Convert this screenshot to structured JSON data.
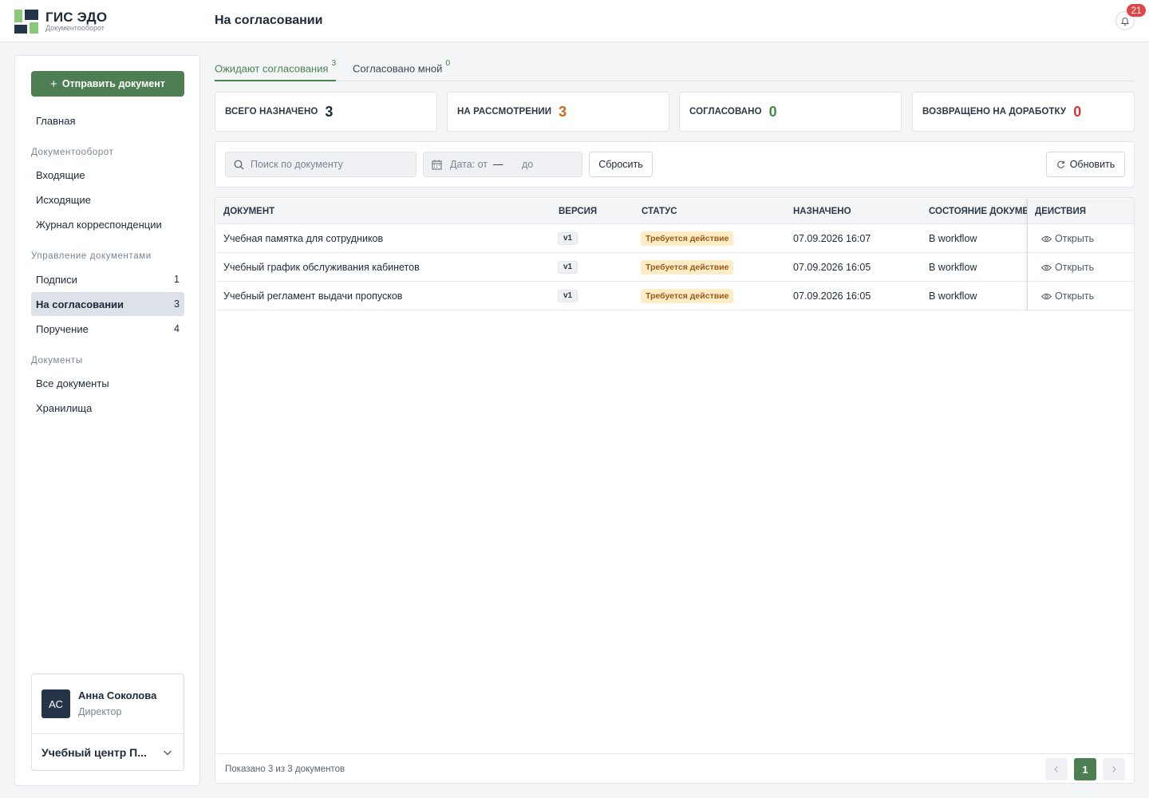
{
  "app": {
    "logo_title": "ГИС ЭДО",
    "logo_subtitle": "Документооборот",
    "page_title": "На согласовании",
    "notification_count": "21"
  },
  "sidebar": {
    "send_button": "Отправить документ",
    "home": "Главная",
    "section_docflow": "Документооборот",
    "incoming": "Входящие",
    "outgoing": "Исходящие",
    "journal": "Журнал корреспонденции",
    "section_manage": "Управление документами",
    "signatures": {
      "label": "Подписи",
      "count": "1"
    },
    "approval": {
      "label": "На согласовании",
      "count": "3"
    },
    "assignment": {
      "label": "Поручение",
      "count": "4"
    },
    "section_docs": "Документы",
    "all_docs": "Все документы",
    "storages": "Хранилища"
  },
  "user": {
    "initials": "АС",
    "name": "Анна Соколова",
    "role": "Директор",
    "org": "Учебный центр П..."
  },
  "tabs": [
    {
      "label": "Ожидают согласования",
      "count": "3"
    },
    {
      "label": "Согласовано мной",
      "count": "0"
    }
  ],
  "stats": [
    {
      "label": "ВСЕГО НАЗНАЧЕНО",
      "value": "3",
      "color": "#1e2a38"
    },
    {
      "label": "НА РАССМОТРЕНИИ",
      "value": "3",
      "color": "#c7681c"
    },
    {
      "label": "СОГЛАСОВАНО",
      "value": "0",
      "color": "#3f8a46"
    },
    {
      "label": "ВОЗВРАЩЕНО НА ДОРАБОТКУ",
      "value": "0",
      "color": "#d03a3a"
    }
  ],
  "filters": {
    "search_placeholder": "Поиск по документу",
    "date_from": "Дата: от",
    "date_dash": "—",
    "date_to": "до",
    "reset": "Сбросить",
    "refresh": "Обновить"
  },
  "table": {
    "headers": {
      "document": "ДОКУМЕНТ",
      "version": "ВЕРСИЯ",
      "status": "СТАТУС",
      "assigned": "НАЗНАЧЕНО",
      "state": "СОСТОЯНИЕ ДОКУМЕНТА",
      "actions": "ДЕЙСТВИЯ"
    },
    "rows": [
      {
        "document": "Учебная памятка для сотрудников",
        "version": "v1",
        "status": "Требуется действие",
        "assigned": "07.09.2026 16:07",
        "state": "В workflow",
        "action": "Открыть"
      },
      {
        "document": "Учебный график обслуживания кабинетов",
        "version": "v1",
        "status": "Требуется действие",
        "assigned": "07.09.2026 16:05",
        "state": "В workflow",
        "action": "Открыть"
      },
      {
        "document": "Учебный регламент выдачи пропусков",
        "version": "v1",
        "status": "Требуется действие",
        "assigned": "07.09.2026 16:05",
        "state": "В workflow",
        "action": "Открыть"
      }
    ],
    "footer": "Показано 3 из 3 документов",
    "current_page": "1"
  },
  "colors": {
    "accent": "#4d7f52",
    "brand_dark": "#24354a",
    "brand_light": "#8bc77b",
    "status_bg": "#fdedc6",
    "notification": "#e04545"
  }
}
